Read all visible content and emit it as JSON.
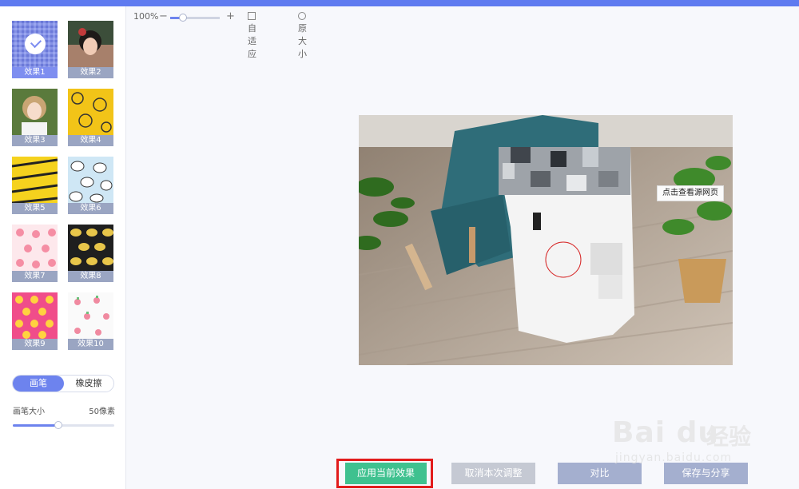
{
  "app": {
    "title_fragment": ""
  },
  "effects": [
    {
      "label": "效果1",
      "selected": true
    },
    {
      "label": "效果2",
      "selected": false
    },
    {
      "label": "效果3",
      "selected": false
    },
    {
      "label": "效果4",
      "selected": false
    },
    {
      "label": "效果5",
      "selected": false
    },
    {
      "label": "效果6",
      "selected": false
    },
    {
      "label": "效果7",
      "selected": false
    },
    {
      "label": "效果8",
      "selected": false
    },
    {
      "label": "效果9",
      "selected": false
    },
    {
      "label": "效果10",
      "selected": false
    }
  ],
  "brush": {
    "tabs": [
      "画笔",
      "橡皮擦"
    ],
    "active_tab": "画笔",
    "size_label": "画笔大小",
    "size_value": "50像素",
    "size_fraction": 0.45
  },
  "toolbar": {
    "zoom_value": "100%",
    "zoom_minus": "−",
    "zoom_plus": "+",
    "zoom_fraction": 0.25,
    "fit_label": "自适应",
    "original_label": "原大小"
  },
  "canvas": {
    "tooltip": "点击查看源网页"
  },
  "actions": {
    "apply": "应用当前效果",
    "cancel": "取消本次调整",
    "compare": "对比",
    "save": "保存与分享"
  },
  "watermark": {
    "brand": "Bai du",
    "cn": "经验",
    "url": "jingyan.baidu.com"
  },
  "colors": {
    "accent": "#6d83ee",
    "apply": "#3fc18f",
    "highlight": "#e21c1c"
  }
}
